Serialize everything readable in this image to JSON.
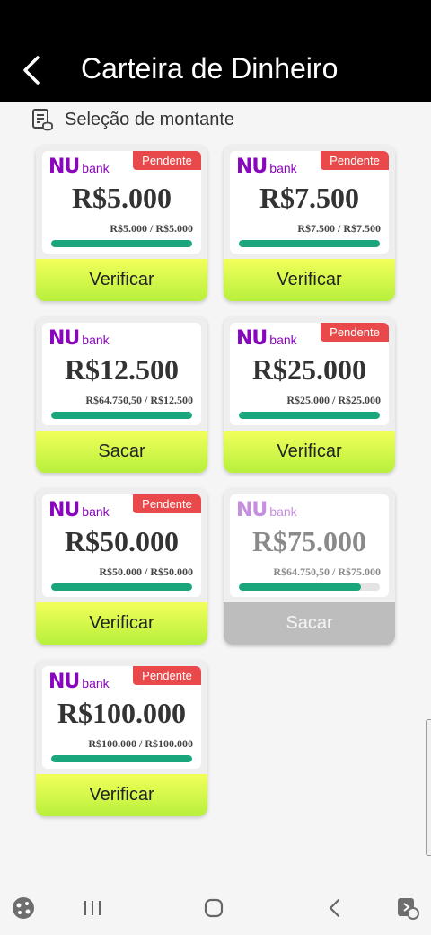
{
  "header": {
    "title": "Carteira de Dinheiro"
  },
  "section": {
    "label": "Seleção de montante"
  },
  "cards": [
    {
      "brand_nu": "NU",
      "brand_bank": "bank",
      "badge": "Pendente",
      "amount": "R$5.000",
      "progress_text": "R$5.000 / R$5.000",
      "progress": 1.0,
      "button": "Verificar"
    },
    {
      "brand_nu": "NU",
      "brand_bank": "bank",
      "badge": "Pendente",
      "amount": "R$7.500",
      "progress_text": "R$7.500 / R$7.500",
      "progress": 1.0,
      "button": "Verificar"
    },
    {
      "brand_nu": "NU",
      "brand_bank": "bank",
      "badge": "",
      "amount": "R$12.500",
      "progress_text": "R$64.750,50 / R$12.500",
      "progress": 1.0,
      "button": "Sacar"
    },
    {
      "brand_nu": "NU",
      "brand_bank": "bank",
      "badge": "Pendente",
      "amount": "R$25.000",
      "progress_text": "R$25.000 / R$25.000",
      "progress": 1.0,
      "button": "Verificar"
    },
    {
      "brand_nu": "NU",
      "brand_bank": "bank",
      "badge": "Pendente",
      "amount": "R$50.000",
      "progress_text": "R$50.000 / R$50.000",
      "progress": 1.0,
      "button": "Verificar"
    },
    {
      "brand_nu": "NU",
      "brand_bank": "bank",
      "badge": "",
      "amount": "R$75.000",
      "progress_text": "R$64.750,50 / R$75.000",
      "progress": 0.8633,
      "button": "Sacar",
      "disabled": true
    },
    {
      "brand_nu": "NU",
      "brand_bank": "bank",
      "badge": "Pendente",
      "amount": "R$100.000",
      "progress_text": "R$100.000 / R$100.000",
      "progress": 1.0,
      "button": "Verificar"
    }
  ],
  "colors": {
    "accent_green": "#1aa67d",
    "badge_red": "#e9494a",
    "brand_purple": "#8a05be"
  },
  "navbar": {
    "icons": [
      "game-launcher-icon",
      "recent-apps-icon",
      "home-icon",
      "back-icon",
      "screen-tool-icon"
    ]
  }
}
